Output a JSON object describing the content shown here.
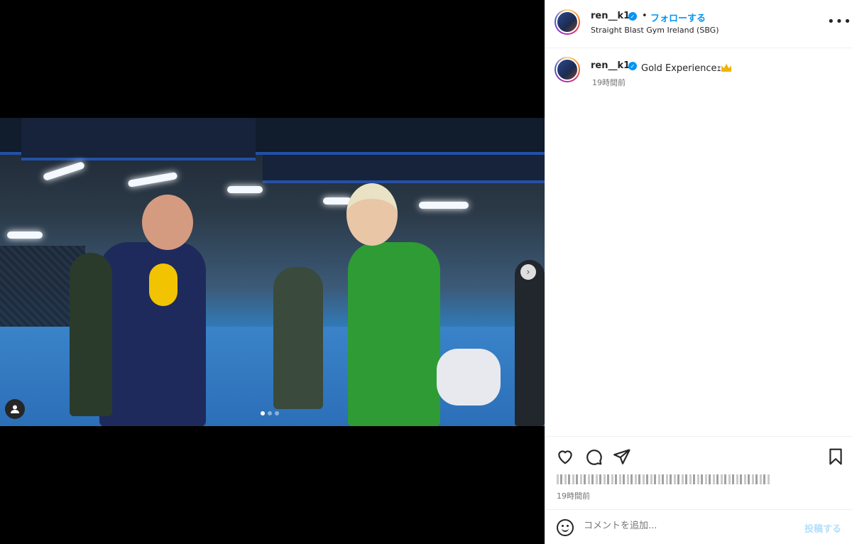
{
  "post": {
    "username": "ren__k1",
    "verified": true,
    "separator": "•",
    "follow_label": "フォローする",
    "location": "Straight Blast Gym Ireland (SBG)",
    "more_icon": "more-options-icon",
    "more_label": "•••"
  },
  "caption": {
    "username": "ren__k1",
    "text": "Gold Experienceｪ",
    "emoji": "crown",
    "time": "19時間前"
  },
  "actions": {
    "icons": [
      "heart-icon",
      "comment-icon",
      "share-icon",
      "bookmark-icon"
    ],
    "time": "19時間前"
  },
  "comment": {
    "placeholder": "コメントを追加...",
    "post_label": "投稿する"
  },
  "media": {
    "slides_total": 3,
    "current_slide": 1
  },
  "colors": {
    "accent": "#0095f6",
    "text": "#262626",
    "muted": "#737373",
    "post_disabled": "#b2dffc"
  }
}
